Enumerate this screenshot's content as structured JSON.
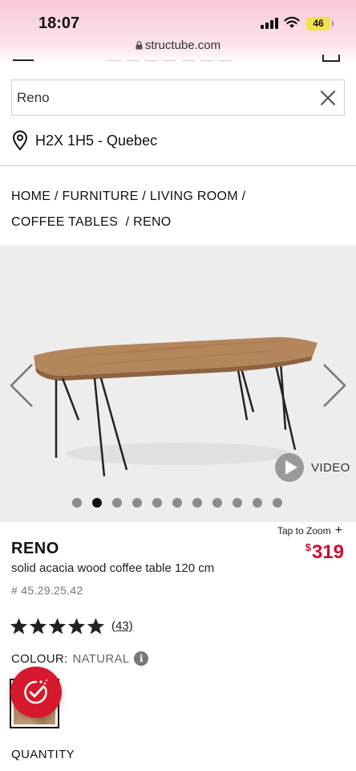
{
  "status_bar": {
    "time": "18:07",
    "battery": "46"
  },
  "browser": {
    "url": "structube.com"
  },
  "search": {
    "value": "Reno"
  },
  "location": {
    "text": "H2X 1H5 - Quebec"
  },
  "breadcrumb": {
    "items": [
      "HOME",
      "FURNITURE",
      "LIVING ROOM",
      "COFFEE TABLES",
      "RENO"
    ],
    "separator": "/"
  },
  "gallery": {
    "video_label": "VIDEO",
    "dot_count": 11,
    "active_index": 1
  },
  "product": {
    "tap_to_zoom": "Tap to Zoom",
    "zoom_plus": "+",
    "name": "RENO",
    "description": "solid acacia wood coffee table 120 cm",
    "sku": "# 45.29.25.42",
    "currency": "$",
    "price": "319",
    "rating": 5,
    "review_count": "(43)",
    "colour_label": "COLOUR:",
    "colour_value": "NATURAL",
    "info_glyph": "i",
    "quantity_label": "QUANTITY"
  },
  "colors": {
    "price": "#c8102e",
    "promo_badge": "#d7192d",
    "gallery_bg": "#ededed"
  },
  "icons": [
    "lock-icon",
    "clear-icon",
    "location-pin-icon",
    "arrow-left-icon",
    "arrow-right-icon",
    "play-icon",
    "star-icon",
    "info-icon",
    "promo-icon"
  ]
}
